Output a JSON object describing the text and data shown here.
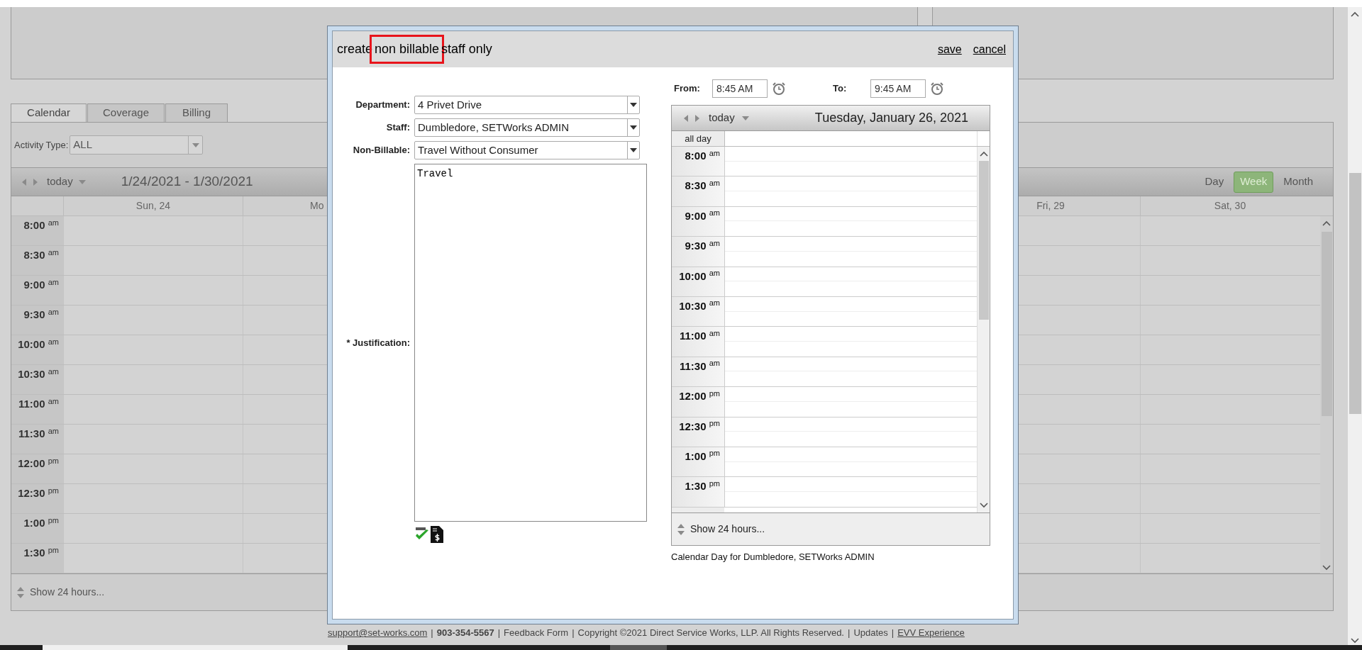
{
  "page": {
    "tabs": [
      {
        "label": "Calendar",
        "selected": true
      },
      {
        "label": "Coverage",
        "selected": false
      },
      {
        "label": "Billing",
        "selected": false
      }
    ],
    "activity_type": {
      "label": "Activity Type:",
      "value": "ALL"
    },
    "calendar": {
      "today": "today",
      "range": "1/24/2021 - 1/30/2021",
      "views": [
        {
          "label": "Day",
          "selected": false
        },
        {
          "label": "Week",
          "selected": true
        },
        {
          "label": "Month",
          "selected": false
        }
      ],
      "columns_left": [
        "Sun, 24",
        "Mo"
      ],
      "columns_right": [
        "Fri, 29",
        "Sat, 30"
      ],
      "times": [
        {
          "time": "8:00",
          "period": "am"
        },
        {
          "time": "8:30",
          "period": "am"
        },
        {
          "time": "9:00",
          "period": "am"
        },
        {
          "time": "9:30",
          "period": "am"
        },
        {
          "time": "10:00",
          "period": "am"
        },
        {
          "time": "10:30",
          "period": "am"
        },
        {
          "time": "11:00",
          "period": "am"
        },
        {
          "time": "11:30",
          "period": "am"
        },
        {
          "time": "12:00",
          "period": "pm"
        },
        {
          "time": "12:30",
          "period": "pm"
        },
        {
          "time": "1:00",
          "period": "pm"
        },
        {
          "time": "1:30",
          "period": "pm"
        }
      ],
      "show_24": "Show 24 hours..."
    }
  },
  "footer": [
    {
      "kind": "link",
      "text": "support@set-works.com"
    },
    {
      "kind": "sep",
      "text": "|"
    },
    {
      "kind": "bold",
      "text": "903-354-5567"
    },
    {
      "kind": "sep",
      "text": "|"
    },
    {
      "kind": "text",
      "text": "Feedback Form"
    },
    {
      "kind": "sep",
      "text": "|"
    },
    {
      "kind": "text",
      "text": "Copyright ©2021 Direct Service Works, LLP. All Rights Reserved."
    },
    {
      "kind": "sep",
      "text": "|"
    },
    {
      "kind": "text",
      "text": "Updates"
    },
    {
      "kind": "sep",
      "text": "|"
    },
    {
      "kind": "link",
      "text": "EVV Experience"
    }
  ],
  "dialog": {
    "title": [
      {
        "text": "create",
        "highlighted": false
      },
      {
        "text": "non billable",
        "highlighted": true
      },
      {
        "text": "staff only",
        "highlighted": false
      }
    ],
    "actions": [
      "save",
      "cancel"
    ],
    "fields": [
      {
        "label": "Department:",
        "value": "4 Privet Drive"
      },
      {
        "label": "Staff:",
        "value": "Dumbledore, SETWorks ADMIN"
      },
      {
        "label": "Non-Billable:",
        "value": "Travel Without Consumer"
      }
    ],
    "justification": {
      "label": "* Justification:",
      "value": "Travel"
    },
    "from": {
      "label": "From:",
      "value": "8:45 AM"
    },
    "to": {
      "label": "To:",
      "value": "9:45 AM"
    },
    "day_calendar": {
      "today": "today",
      "date": "Tuesday, January 26, 2021",
      "all_day": "all day",
      "times": [
        {
          "time": "8:00",
          "period": "am"
        },
        {
          "time": "8:30",
          "period": "am"
        },
        {
          "time": "9:00",
          "period": "am"
        },
        {
          "time": "9:30",
          "period": "am"
        },
        {
          "time": "10:00",
          "period": "am"
        },
        {
          "time": "10:30",
          "period": "am"
        },
        {
          "time": "11:00",
          "period": "am"
        },
        {
          "time": "11:30",
          "period": "am"
        },
        {
          "time": "12:00",
          "period": "pm"
        },
        {
          "time": "12:30",
          "period": "pm"
        },
        {
          "time": "1:00",
          "period": "pm"
        },
        {
          "time": "1:30",
          "period": "pm"
        }
      ],
      "show_24": "Show 24 hours...",
      "caption": "Calendar Day for Dumbledore, SETWorks ADMIN"
    }
  }
}
